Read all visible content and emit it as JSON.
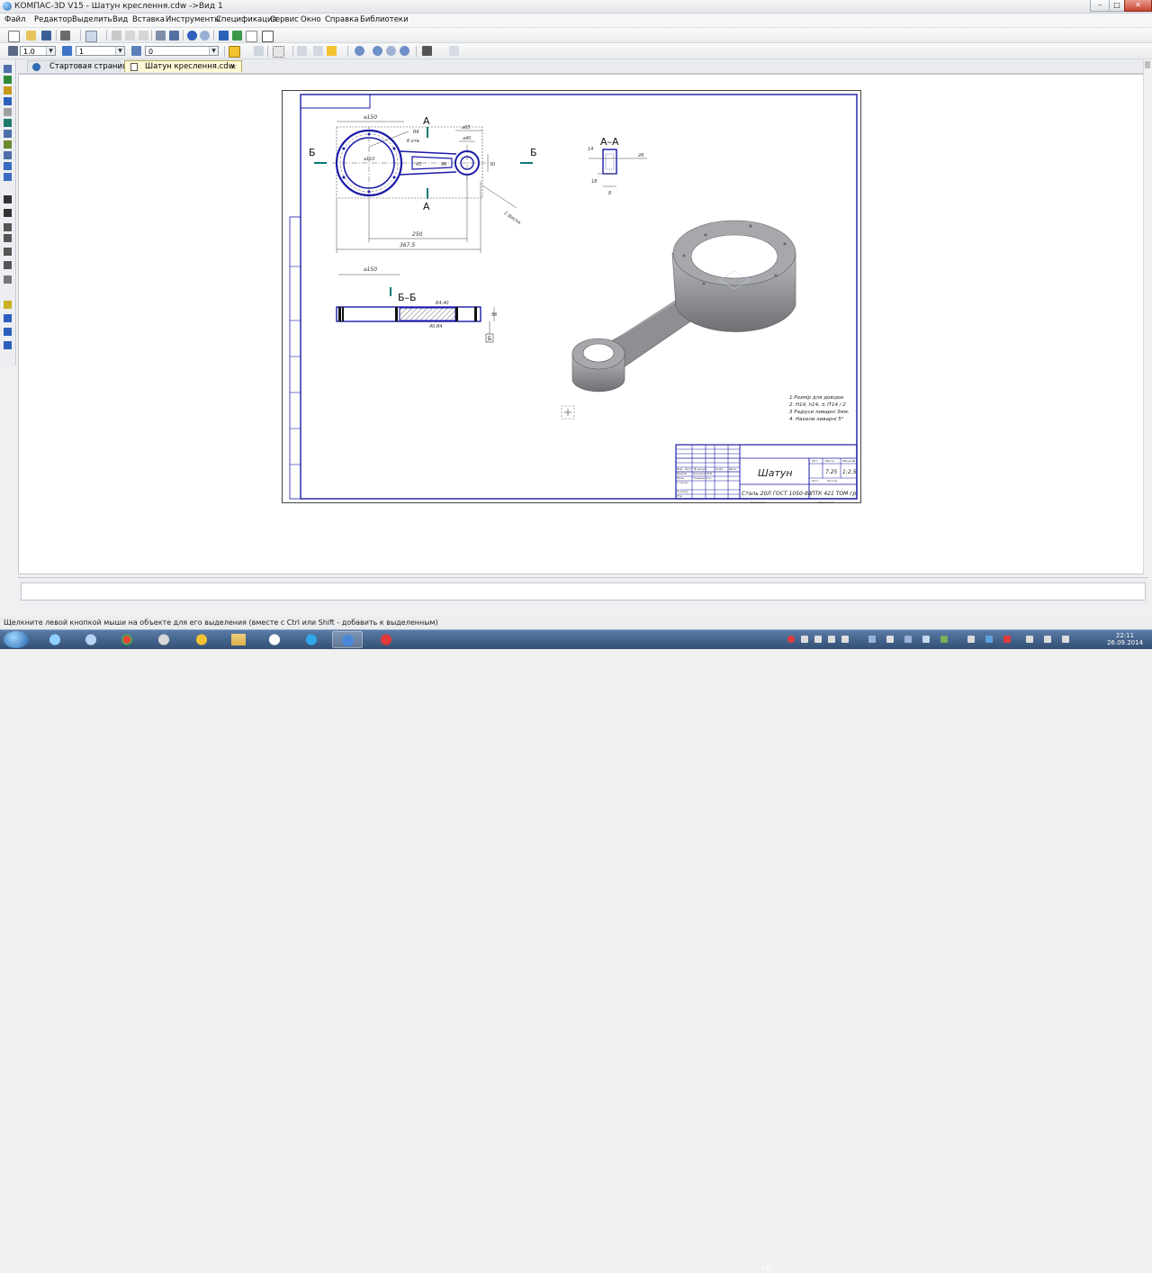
{
  "window": {
    "title": "КОМПАС-3D V15 - Шатун креслення.cdw ->Вид 1",
    "controls": {
      "minimize": "–",
      "maximize": "□",
      "close": "✕"
    }
  },
  "menu": [
    "Файл",
    "Редактор",
    "Выделить",
    "Вид",
    "Вставка",
    "Инструменты",
    "Спецификация",
    "Сервис",
    "Окно",
    "Справка",
    "Библиотеки"
  ],
  "toolbar2": {
    "scale_value": "1.0",
    "layer_value": "1",
    "style_value": "0"
  },
  "tabs": [
    {
      "label": "Стартовая страница",
      "active": false
    },
    {
      "label": "Шатун креслення.cdw",
      "active": true,
      "close": "✕"
    }
  ],
  "drawing": {
    "front": {
      "dim_d150": "⌀150",
      "dim_d110": "⌀110",
      "dim_d65": "⌀65",
      "dim_d40": "⌀40",
      "dim_250": "250",
      "dim_3675": "367.5",
      "holes_note": "6 отв.",
      "r_note": "R6",
      "dim_30": "30",
      "dim_45": "45",
      "dim_43": "43",
      "dim_96": "96",
      "chamfer": "1 фаска",
      "section_a_top": "А",
      "section_a_bottom": "А",
      "section_b_left": "Б",
      "section_b_right": "Б"
    },
    "section_aa": {
      "title": "А–А",
      "dim_26": "26",
      "dim_18": "18",
      "dim_14": "14",
      "dim_8": "8"
    },
    "bottom_view": {
      "dim_d150": "⌀150",
      "title": "Б–Б",
      "dim_top": "R4.40",
      "dim_bot": "40.R4",
      "dim_right": "56",
      "datum": "Б"
    },
    "notes": [
      "1 Розмір для довідок",
      "2. H14, h14, ± IT14 / 2",
      "3 Радіуси ливарні 3мм.",
      "4. Нахили ливарні 5°"
    ],
    "stamp": {
      "name": "Шатун",
      "material": "Сталь 20Л ГОСТ 1050-88",
      "org": "ПТК 421 ТОМ гр",
      "mass": "7.25",
      "scale": "1:2.5",
      "lit_label": "Лит.",
      "mass_label": "Масса",
      "scale_label": "Масштаб",
      "sheet_label": "Лист",
      "sheets_label": "Листов",
      "copy_label": "Копировал",
      "format_label": "Формат  А3",
      "rows": [
        "Изм.",
        "Лист",
        "№ докум.",
        "Подп.",
        "Дата",
        "Разраб.",
        "Пров.",
        "Т.контр.",
        "Н.контр.",
        "Утв."
      ],
      "developer": "Кузнецов В.В.",
      "checker": "Тищенко С.С."
    }
  },
  "status": {
    "message": "Щелкните левой кнопкой мыши на объекте для его выделения (вместе с Ctrl или Shift - добавить к выделенным)"
  },
  "taskbar": {
    "lang": "EN",
    "time": "22:11",
    "date": "26.09.2014",
    "apps": [
      "start-orb",
      "internet-explorer",
      "kompas",
      "chrome",
      "solidworks",
      "norton",
      "explorer",
      "autocad",
      "skype",
      "kompas-active",
      "opera"
    ]
  },
  "colors": {
    "outline_blue": "#1a1aa8",
    "section_green": "#0a7a74",
    "part_gray": "#8e8f93",
    "taskbar": "#3c5a80"
  }
}
